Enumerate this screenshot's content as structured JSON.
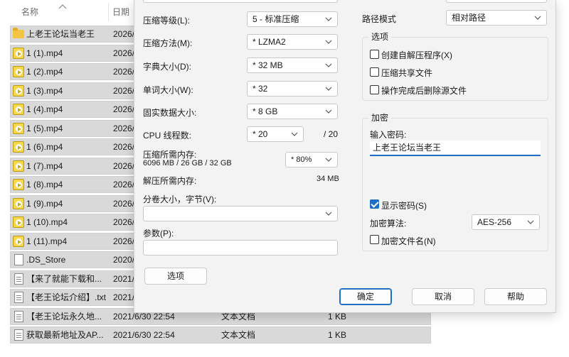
{
  "explorer": {
    "col_name": "名称",
    "col_date": "日期",
    "files": [
      {
        "icon": "folder-icon",
        "name": "上老王论坛当老王",
        "date": "2026/",
        "type": "",
        "size": ""
      },
      {
        "icon": "video-file-icon",
        "name": "1 (1).mp4",
        "date": "2026/",
        "type": "",
        "size": ""
      },
      {
        "icon": "video-file-icon",
        "name": "1 (2).mp4",
        "date": "2026/",
        "type": "",
        "size": ""
      },
      {
        "icon": "video-file-icon",
        "name": "1 (3).mp4",
        "date": "2026/",
        "type": "",
        "size": ""
      },
      {
        "icon": "video-file-icon",
        "name": "1 (4).mp4",
        "date": "2026/",
        "type": "",
        "size": ""
      },
      {
        "icon": "video-file-icon",
        "name": "1 (5).mp4",
        "date": "2026/",
        "type": "",
        "size": ""
      },
      {
        "icon": "video-file-icon",
        "name": "1 (6).mp4",
        "date": "2026/",
        "type": "",
        "size": ""
      },
      {
        "icon": "video-file-icon",
        "name": "1 (7).mp4",
        "date": "2026/",
        "type": "",
        "size": ""
      },
      {
        "icon": "video-file-icon",
        "name": "1 (8).mp4",
        "date": "2026/",
        "type": "",
        "size": ""
      },
      {
        "icon": "video-file-icon",
        "name": "1 (9).mp4",
        "date": "2026/",
        "type": "",
        "size": ""
      },
      {
        "icon": "video-file-icon",
        "name": "1 (10).mp4",
        "date": "2026/",
        "type": "",
        "size": ""
      },
      {
        "icon": "video-file-icon",
        "name": "1 (11).mp4",
        "date": "2026/",
        "type": "",
        "size": ""
      },
      {
        "icon": "blank-file-icon",
        "name": ".DS_Store",
        "date": "2020/",
        "type": "",
        "size": ""
      },
      {
        "icon": "text-file-icon",
        "name": "【来了就能下载和...",
        "date": "2021/",
        "type": "",
        "size": ""
      },
      {
        "icon": "text-file-icon",
        "name": "【老王论坛介绍】.txt",
        "date": "2021/",
        "type": "",
        "size": ""
      },
      {
        "icon": "text-file-icon",
        "name": "【老王论坛永久地...",
        "date": "2021/6/30 22:54",
        "type": "文本文档",
        "size": "1 KB"
      },
      {
        "icon": "text-file-icon",
        "name": "获取最新地址及AP...",
        "date": "2021/6/30 22:54",
        "type": "文本文档",
        "size": "1 KB"
      }
    ]
  },
  "dialog": {
    "compression_level": {
      "label": "压缩等级(L):",
      "value": "5 - 标准压缩"
    },
    "compression_method": {
      "label": "压缩方法(M):",
      "value": "* LZMA2"
    },
    "dictionary_size": {
      "label": "字典大小(D):",
      "value": "* 32 MB"
    },
    "word_size": {
      "label": "单词大小(W):",
      "value": "* 32"
    },
    "solid_block_size": {
      "label": "固实数据大小:",
      "value": "* 8 GB"
    },
    "cpu_threads": {
      "label": "CPU 线程数:",
      "value": "* 20",
      "max": "/ 20"
    },
    "memory_compress": {
      "label": "压缩所需内存:",
      "detail": "6096 MB / 26 GB / 32 GB",
      "value": "* 80%"
    },
    "memory_decompress": {
      "label": "解压所需内存:",
      "value": "34 MB"
    },
    "split_volumes": {
      "label": "分卷大小，字节(V):",
      "value": ""
    },
    "parameters": {
      "label": "参数(P):",
      "value": ""
    },
    "options_button": "选项",
    "path_mode": {
      "label": "路径模式",
      "value": "相对路径"
    },
    "options_group": {
      "title": "选项",
      "items": [
        {
          "label": "创建自解压程序(X)",
          "checked": false
        },
        {
          "label": "压缩共享文件",
          "checked": false
        },
        {
          "label": "操作完成后删除源文件",
          "checked": false
        }
      ]
    },
    "encryption": {
      "title": "加密",
      "password_label": "输入密码:",
      "password_value": "上老王论坛当老王",
      "show_password": {
        "label": "显示密码(S)",
        "checked": true
      },
      "method_label": "加密算法:",
      "method_value": "AES-256",
      "encrypt_names": {
        "label": "加密文件名(N)",
        "checked": false
      }
    },
    "ok_button": "确定",
    "cancel_button": "取消",
    "help_button": "帮助"
  },
  "colors": {
    "accent": "#1f6fc5",
    "dialog_bg": "#f3f3f3",
    "row_selected": "#d9d9d9"
  }
}
